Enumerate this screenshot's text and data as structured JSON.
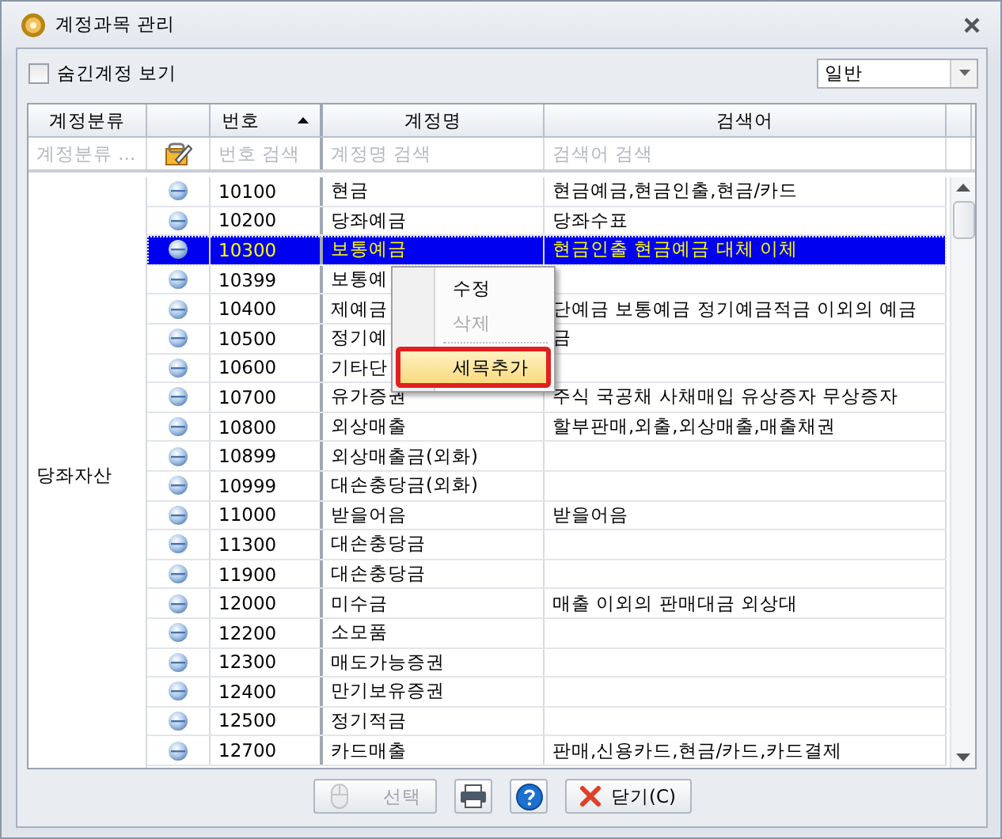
{
  "window": {
    "title": "계정과목 관리"
  },
  "hidden_accounts": {
    "label": "숨긴계정 보기",
    "checked": false
  },
  "view_select": {
    "value": "일반"
  },
  "columns": [
    {
      "label": "계정분류",
      "sorted": false
    },
    {
      "sorted": false
    },
    {
      "label": "번호",
      "sorted": true
    },
    {
      "label": "계정명",
      "sorted": false
    },
    {
      "label": "검색어",
      "sorted": false
    }
  ],
  "filters": [
    "계정분류 ...",
    "번호 검색",
    "계정명 검색",
    "검색어 검색"
  ],
  "groups": [
    {
      "category": "당좌자산",
      "rows": [
        {
          "number": "10100",
          "name": "현금",
          "search_terms": "현금예금,현금인출,현금/카드",
          "selected": false
        },
        {
          "number": "10200",
          "name": "당좌예금",
          "search_terms": "당좌수표",
          "selected": false
        },
        {
          "number": "10300",
          "name": "보통예금",
          "search_terms": "현금인출 현금예금 대체 이체",
          "selected": true
        },
        {
          "number": "10399",
          "name": "보통예",
          "search_terms": "",
          "selected": false
        },
        {
          "number": "10400",
          "name": "제예금",
          "search_terms": "단예금 보통예금 정기예금적금 이외의 예금",
          "selected": false
        },
        {
          "number": "10500",
          "name": "정기예",
          "search_terms": "금",
          "selected": false
        },
        {
          "number": "10600",
          "name": "기타단",
          "search_terms": "",
          "selected": false
        },
        {
          "number": "10700",
          "name": "유가증권",
          "search_terms": "주식 국공채 사채매입 유상증자 무상증자",
          "selected": false
        },
        {
          "number": "10800",
          "name": "외상매출",
          "search_terms": "할부판매,외출,외상매출,매출채권",
          "selected": false
        },
        {
          "number": "10899",
          "name": "외상매출금(외화)",
          "search_terms": "",
          "selected": false
        },
        {
          "number": "10999",
          "name": "대손충당금(외화)",
          "search_terms": "",
          "selected": false
        },
        {
          "number": "11000",
          "name": "받을어음",
          "search_terms": "받을어음",
          "selected": false
        },
        {
          "number": "11300",
          "name": "대손충당금",
          "search_terms": "",
          "selected": false
        },
        {
          "number": "11900",
          "name": "대손충당금",
          "search_terms": "",
          "selected": false
        },
        {
          "number": "12000",
          "name": "미수금",
          "search_terms": "매출 이외의 판매대금 외상대",
          "selected": false
        },
        {
          "number": "12200",
          "name": "소모품",
          "search_terms": "",
          "selected": false
        },
        {
          "number": "12300",
          "name": "매도가능증권",
          "search_terms": "",
          "selected": false
        },
        {
          "number": "12400",
          "name": "만기보유증권",
          "search_terms": "",
          "selected": false
        },
        {
          "number": "12500",
          "name": "정기적금",
          "search_terms": "",
          "selected": false
        },
        {
          "number": "12700",
          "name": "카드매출",
          "search_terms": "판매,신용카드,현금/카드,카드결제",
          "selected": false
        }
      ]
    }
  ],
  "context_menu": [
    {
      "label": "수정",
      "disabled": false,
      "selected": false
    },
    {
      "label": "삭제",
      "disabled": true,
      "selected": false
    },
    {
      "label": "세목추가",
      "disabled": false,
      "selected": true
    }
  ],
  "buttons": [
    {
      "kind": "select",
      "label": "선택",
      "disabled": true
    },
    {
      "kind": "print",
      "disabled": false
    },
    {
      "kind": "help",
      "disabled": false
    },
    {
      "kind": "close",
      "label": "닫기(C)",
      "disabled": false
    }
  ]
}
